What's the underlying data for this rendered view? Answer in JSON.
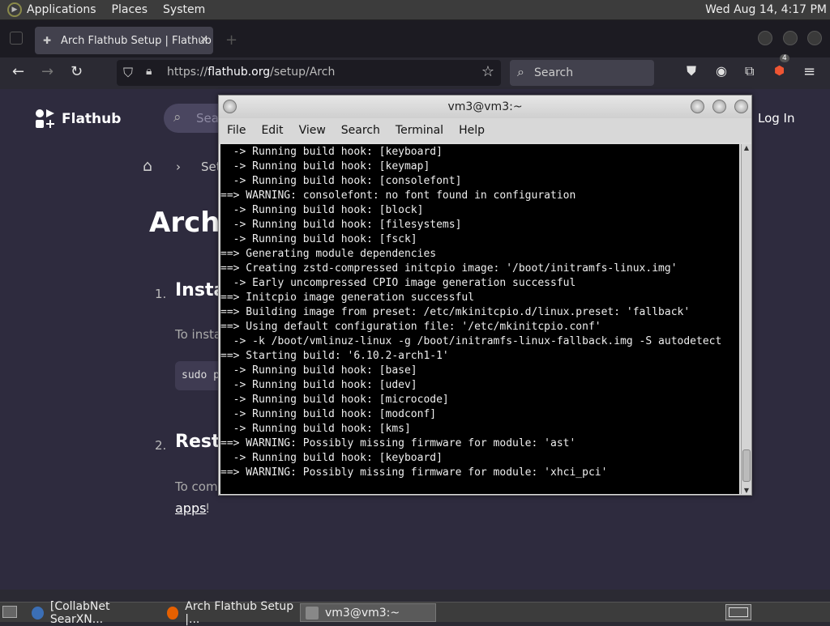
{
  "top_panel": {
    "menus": [
      "Applications",
      "Places",
      "System"
    ],
    "clock": "Wed Aug 14,  4:17 PM"
  },
  "browser": {
    "tab_title": "Arch Flathub Setup | Flathub",
    "url_prefix": "https://",
    "url_host": "flathub.org",
    "url_path": "/setup/Arch",
    "search_placeholder": "Search",
    "extension_badge": "4"
  },
  "page": {
    "brand": "Flathub",
    "search_placeholder": "Sear",
    "login": "Log In",
    "breadcrumb_partial": "Set",
    "title": "Arch",
    "step1_num": "1.",
    "step1_title": "Insta",
    "step1_text": "To insta",
    "code_partial": "sudo p",
    "step2_num": "2.",
    "step2_title": "Rest",
    "step2_text": "To com",
    "apps_link": "apps",
    "apps_suffix": "!"
  },
  "terminal": {
    "title": "vm3@vm3:~",
    "menu": [
      "File",
      "Edit",
      "View",
      "Search",
      "Terminal",
      "Help"
    ],
    "lines": [
      "  -> Running build hook: [keyboard]",
      "  -> Running build hook: [keymap]",
      "  -> Running build hook: [consolefont]",
      "==> WARNING: consolefont: no font found in configuration",
      "  -> Running build hook: [block]",
      "  -> Running build hook: [filesystems]",
      "  -> Running build hook: [fsck]",
      "==> Generating module dependencies",
      "==> Creating zstd-compressed initcpio image: '/boot/initramfs-linux.img'",
      "  -> Early uncompressed CPIO image generation successful",
      "==> Initcpio image generation successful",
      "==> Building image from preset: /etc/mkinitcpio.d/linux.preset: 'fallback'",
      "==> Using default configuration file: '/etc/mkinitcpio.conf'",
      "  -> -k /boot/vmlinuz-linux -g /boot/initramfs-linux-fallback.img -S autodetect",
      "==> Starting build: '6.10.2-arch1-1'",
      "  -> Running build hook: [base]",
      "  -> Running build hook: [udev]",
      "  -> Running build hook: [microcode]",
      "  -> Running build hook: [modconf]",
      "  -> Running build hook: [kms]",
      "==> WARNING: Possibly missing firmware for module: 'ast'",
      "  -> Running build hook: [keyboard]",
      "==> WARNING: Possibly missing firmware for module: 'xhci_pci'"
    ]
  },
  "taskbar": {
    "tasks": [
      "[CollabNet SearXN...",
      "Arch Flathub Setup |...",
      "vm3@vm3:~"
    ]
  }
}
